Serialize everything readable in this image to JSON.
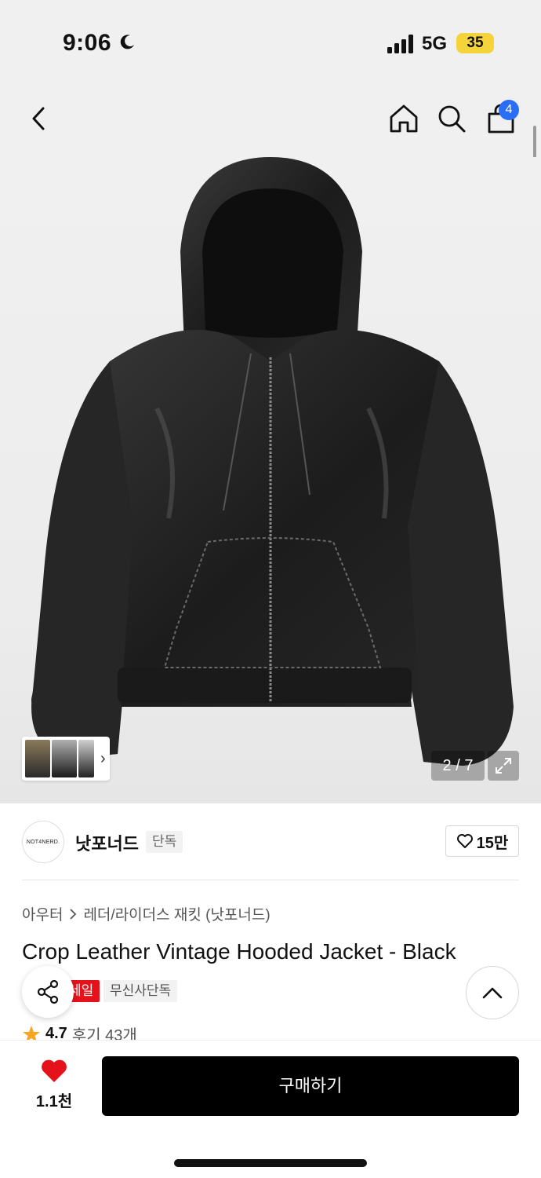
{
  "status": {
    "time": "9:06",
    "network": "5G",
    "battery": "35"
  },
  "header": {
    "back_icon": "chevron-left-icon",
    "home_icon": "home-icon",
    "search_icon": "search-icon",
    "cart_icon": "bag-icon",
    "cart_count": "4"
  },
  "gallery": {
    "counter": "2 / 7",
    "expand_icon": "expand-icon",
    "thumbs_chevron": "›"
  },
  "brand": {
    "logo_text": "NOT4NERD.",
    "name": "낫포너드",
    "tag": "단독",
    "likes": "15만"
  },
  "product": {
    "breadcrumb": [
      "아우터",
      "레더/라이더스 재킷 (낫포너드)"
    ],
    "title": "Crop Leather Vintage Hooded Jacket - Black",
    "tags": [
      "세일",
      "무신사단독"
    ],
    "rating": "4.7",
    "reviews": "후기 43개"
  },
  "bottom": {
    "wish_count": "1.1천",
    "buy_label": "구매하기"
  },
  "colors": {
    "accent_red": "#e5121c",
    "badge_blue": "#2b6ef6",
    "buy_bg": "#000000",
    "rating_star": "#f5a623"
  }
}
